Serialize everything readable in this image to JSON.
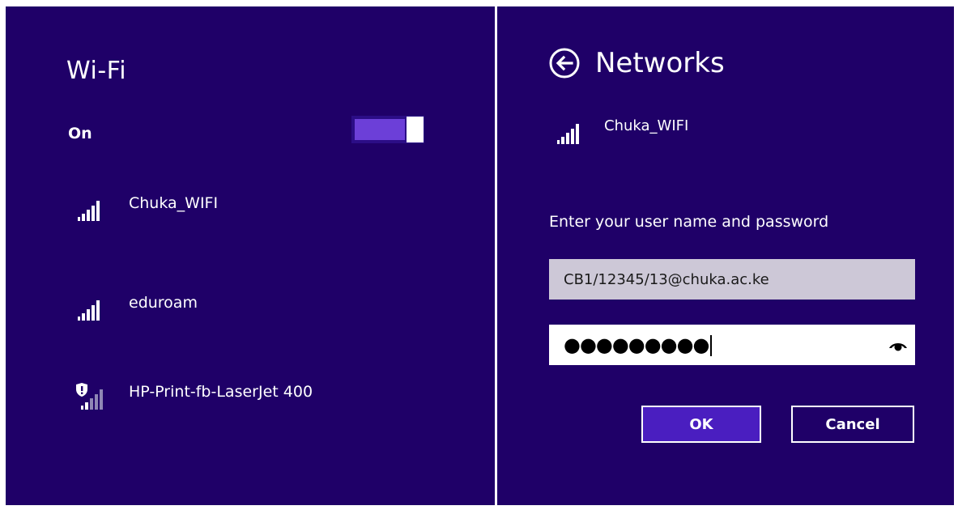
{
  "wifi_panel": {
    "title": "Wi-Fi",
    "toggle_label": "On",
    "toggle_state": "on",
    "networks": [
      {
        "name": "Chuka_WIFI",
        "icon": "signal-full-icon",
        "secured_warning": false
      },
      {
        "name": "eduroam",
        "icon": "signal-full-icon",
        "secured_warning": false
      },
      {
        "name": "HP-Print-fb-LaserJet 400",
        "icon": "signal-weak-shield-icon",
        "secured_warning": true
      }
    ]
  },
  "networks_panel": {
    "title": "Networks",
    "back_icon": "back-arrow-icon",
    "selected_network": {
      "name": "Chuka_WIFI",
      "icon": "signal-full-icon"
    },
    "prompt": "Enter your user name and password",
    "username_value": "CB1/12345/13@chuka.ac.ke",
    "password_masked": "●●●●●●●●●",
    "reveal_icon": "eye-icon",
    "ok_label": "OK",
    "cancel_label": "Cancel"
  },
  "colors": {
    "background": "#1f0068",
    "toggle_fill": "#6c3fd8",
    "ok_button": "#4a1ec0",
    "username_field": "#cdc8d7"
  }
}
